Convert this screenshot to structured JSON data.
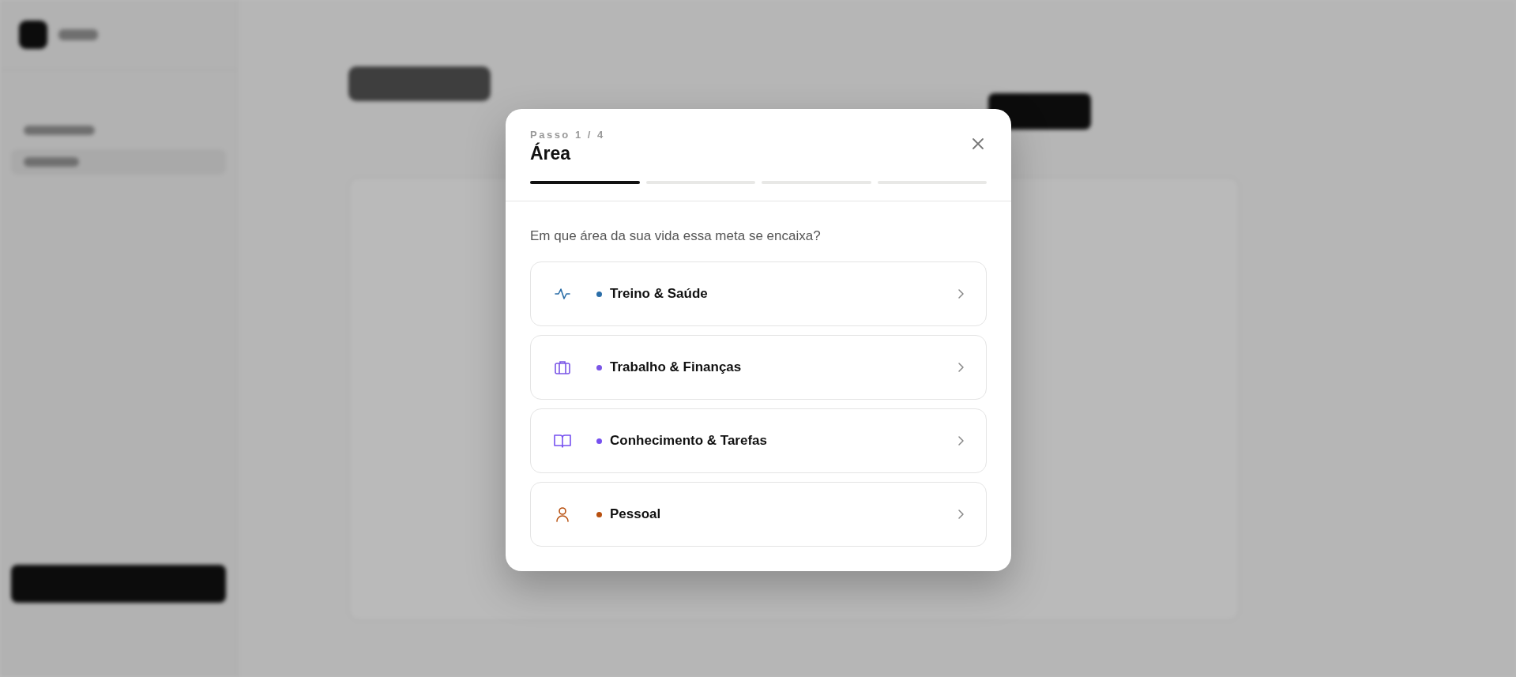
{
  "dialog": {
    "step": "Passo 1 / 4",
    "title": "Área",
    "progress": [
      {
        "done": true
      },
      {
        "done": false
      },
      {
        "done": false
      },
      {
        "done": false
      }
    ],
    "question": "Em que área da sua vida essa meta se encaixa?",
    "areas": [
      {
        "label": "Treino & Saúde",
        "kind": "activity",
        "color": "#2b6ea8"
      },
      {
        "label": "Trabalho & Finanças",
        "kind": "briefcase",
        "color": "#7a55e6"
      },
      {
        "label": "Conhecimento & Tarefas",
        "kind": "book",
        "color": "#7650f0"
      },
      {
        "label": "Pessoal",
        "kind": "person",
        "color": "#b8500f"
      }
    ]
  }
}
